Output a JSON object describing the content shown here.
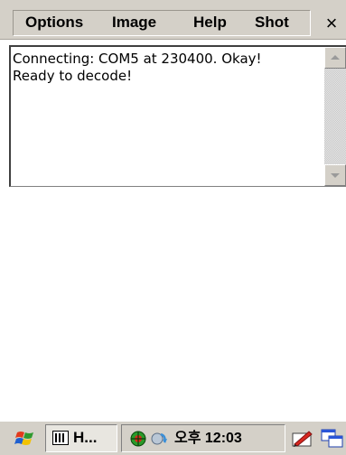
{
  "menubar": {
    "items": [
      "Options",
      "Image",
      "Help",
      "Shot"
    ],
    "close_symbol": "×"
  },
  "output": {
    "lines": [
      "Connecting: COM5 at 230400. Okay!",
      "Ready to decode!"
    ]
  },
  "taskbar": {
    "start_icon": "windows-flag-icon",
    "task_label": "H...",
    "task_icon": "barcode-icon",
    "tray_icons": [
      "network-icon",
      "activesync-icon"
    ],
    "clock_ampm": "오후",
    "clock_time": "12:03",
    "input_icon": "keyboard-pen-icon",
    "switch_icon": "window-switch-icon"
  }
}
